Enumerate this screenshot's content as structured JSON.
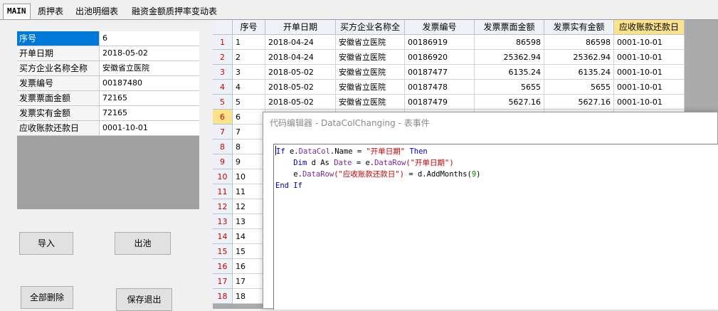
{
  "tabs": [
    "MAIN",
    "质押表",
    "出池明细表",
    "融资金额质押率变动表"
  ],
  "form": {
    "rows": [
      {
        "label": "序号",
        "value": "6"
      },
      {
        "label": "开单日期",
        "value": "2018-05-02"
      },
      {
        "label": "买方企业名称全称",
        "value": "安徽省立医院"
      },
      {
        "label": "发票编号",
        "value": "00187480"
      },
      {
        "label": "发票票面金额",
        "value": "72165"
      },
      {
        "label": "发票实有金额",
        "value": "72165"
      },
      {
        "label": "应收账款还款日",
        "value": "0001-10-01"
      }
    ]
  },
  "buttons": {
    "import": "导入",
    "outpool": "出池",
    "delete_all": "全部删除",
    "save_exit": "保存退出"
  },
  "grid": {
    "columns": [
      "序号",
      "开单日期",
      "买方企业名称全",
      "发票编号",
      "发票票面金额",
      "发票实有金额",
      "应收账款还款日"
    ],
    "rows": [
      [
        "1",
        "2018-04-24",
        "安徽省立医院",
        "00186919",
        "86598",
        "86598",
        "0001-10-01"
      ],
      [
        "2",
        "2018-04-24",
        "安徽省立医院",
        "00186920",
        "25362.94",
        "25362.94",
        "0001-10-01"
      ],
      [
        "3",
        "2018-05-02",
        "安徽省立医院",
        "00187477",
        "6135.24",
        "6135.24",
        "0001-10-01"
      ],
      [
        "4",
        "2018-05-02",
        "安徽省立医院",
        "00187478",
        "5655",
        "5655",
        "0001-10-01"
      ],
      [
        "5",
        "2018-05-02",
        "安徽省立医院",
        "00187479",
        "5627.16",
        "5627.16",
        "0001-10-01"
      ],
      [
        "6"
      ],
      [
        "7"
      ],
      [
        "8"
      ],
      [
        "9"
      ],
      [
        "10"
      ],
      [
        "11"
      ],
      [
        "12"
      ],
      [
        "13"
      ],
      [
        "14"
      ],
      [
        "15"
      ],
      [
        "16"
      ],
      [
        "17"
      ],
      [
        "18"
      ]
    ],
    "row_headers": [
      "1",
      "2",
      "3",
      "4",
      "5",
      "6",
      "7",
      "8",
      "9",
      "10",
      "11",
      "12",
      "13",
      "14",
      "15",
      "16",
      "17",
      "18"
    ]
  },
  "editor": {
    "title": "代码编辑器 - DataColChanging - 表事件",
    "tokens": {
      "if": "If",
      "e1": "e.",
      "datacol": "DataCol",
      "name": ".Name = ",
      "s1": "\"开单日期\"",
      "then": " Then",
      "dim": "Dim",
      "d_as": " d As ",
      "date": "Date",
      "eq": " = e.",
      "datarow1": "DataRow",
      "s2": "(\"开单日期\")",
      "e2": "e.",
      "datarow2": "DataRow",
      "s3": "(\"应收账款还款日\")",
      "assign": " = d.AddMonths(",
      "nine": "9",
      "close": ")",
      "end": "End",
      "if2": " If"
    }
  }
}
